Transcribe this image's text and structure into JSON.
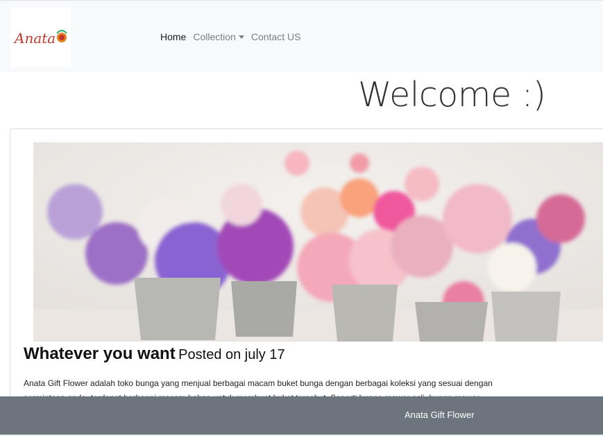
{
  "navbar": {
    "logo_text": "Anata",
    "links": [
      {
        "label": "Home"
      },
      {
        "label": "Collection"
      },
      {
        "label": "Contact US"
      }
    ]
  },
  "welcome_heading": "Welcome :)",
  "post": {
    "title": "Whatever you want",
    "date": "Posted on july 17",
    "text_line1": "Anata Gift Flower adalah toko bunga yang menjual berbagai macam buket bunga dengan berbagai koleksi yang sesuai dengan",
    "text_line2": "permintaan anda, terdapat berbagai macam bahan untuk membuat buket tersebut. Seperti bunga mawar asli, bunga mawar"
  },
  "footer": {
    "text": "Anata Gift Flower"
  },
  "colors": {
    "navbar_bg": "#f8f9fa",
    "footer_bg": "#6c757d",
    "logo_red": "#c0392b"
  }
}
